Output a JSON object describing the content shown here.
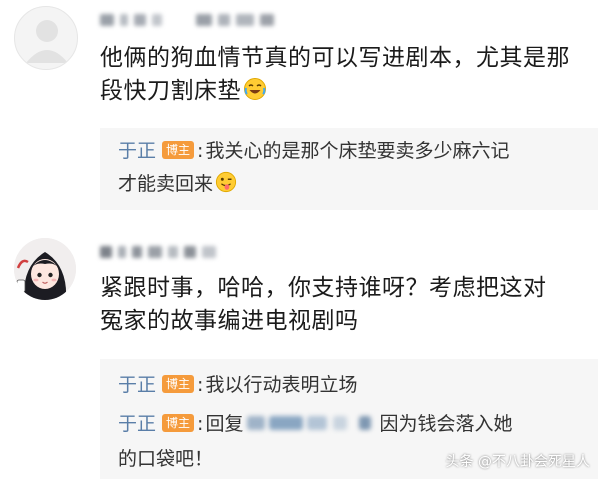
{
  "comments": [
    {
      "text": "他俩的狗血情节真的可以写进剧本，尤其是那段快刀割床垫",
      "emoji": "laughing-crying-emoji",
      "replies": [
        {
          "author": "于正",
          "badge": "博主",
          "line1": "我关心的是那个床垫要卖多少麻六记",
          "line2": "才能卖回来",
          "emoji": "tongue-wink-emoji"
        }
      ]
    },
    {
      "text_line1": "紧跟时事，哈哈，你支持谁呀？考虑把这对",
      "text_line2": "冤家的故事编进电视剧吗",
      "replies": [
        {
          "author": "于正",
          "badge": "博主",
          "text": "我以行动表明立场"
        },
        {
          "author": "于正",
          "badge": "博主",
          "prefix": "回复",
          "suffix": "因为钱会落入她",
          "line2": "的口袋吧！"
        }
      ]
    }
  ],
  "watermark": "头条 @不八卦会死星人",
  "colors": {
    "author": "#5a7ea8",
    "badge": "#f59b3c",
    "reply_bg": "#f6f6f6"
  }
}
